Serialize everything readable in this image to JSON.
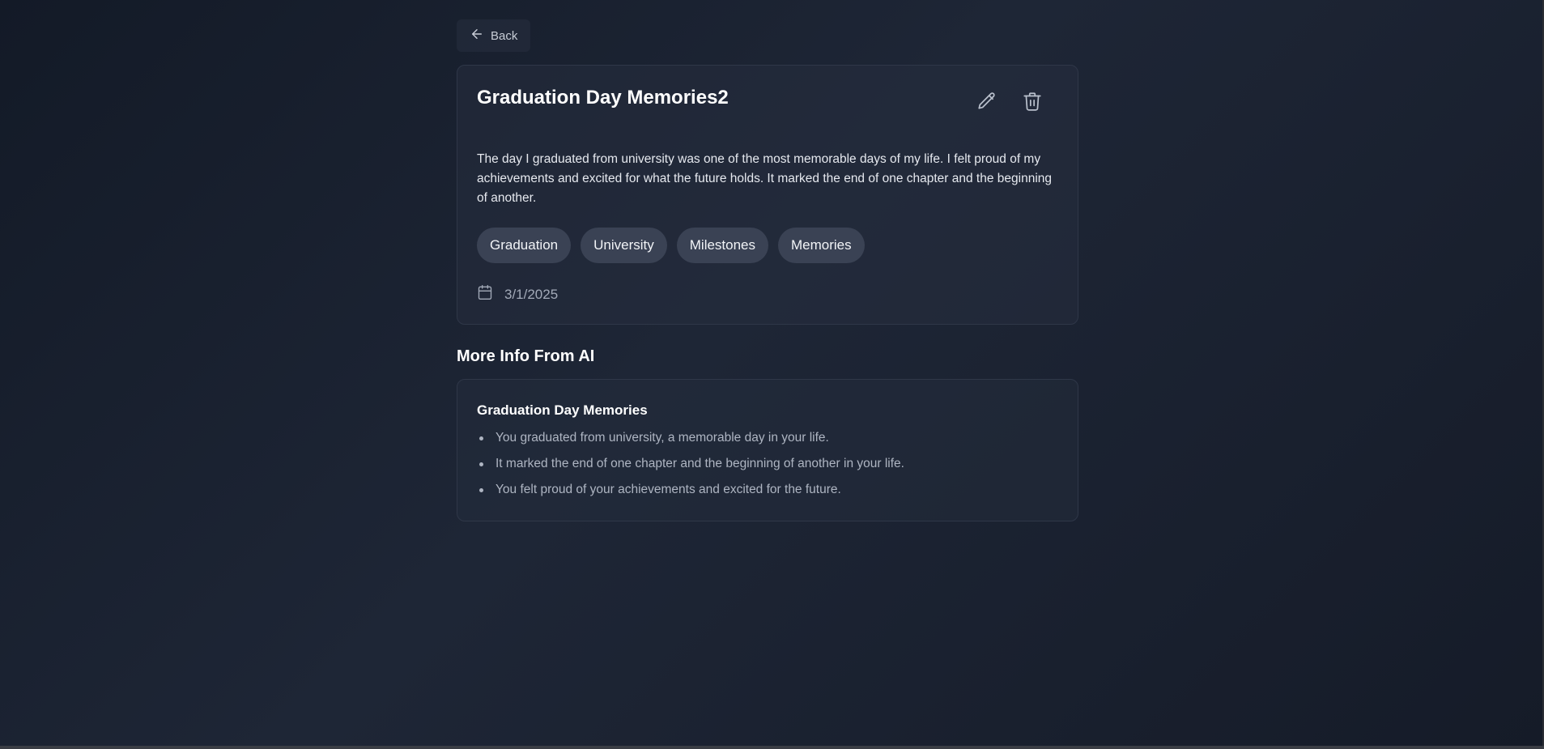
{
  "nav": {
    "back_label": "Back",
    "back_icon": "arrow-left-icon"
  },
  "memory": {
    "title": "Graduation Day Memories2",
    "description": "The day I graduated from university was one of the most memorable days of my life. I felt proud of my achievements and excited for what the future holds. It marked the end of one chapter and the beginning of another.",
    "tags": [
      "Graduation",
      "University",
      "Milestones",
      "Memories"
    ],
    "date": "3/1/2025",
    "actions": {
      "edit_icon": "pencil-icon",
      "delete_icon": "trash-icon"
    }
  },
  "ai_section": {
    "heading": "More Info From AI",
    "card_title": "Graduation Day Memories",
    "points": [
      "You graduated from university, a memorable day in your life.",
      "It marked the end of one chapter and the beginning of another in your life.",
      "You felt proud of your achievements and excited for the future."
    ]
  },
  "colors": {
    "background": "#1a2130",
    "card": "#262e3e",
    "tag": "#3a4254",
    "text_primary": "#ffffff",
    "text_muted": "#aeb5c2"
  }
}
